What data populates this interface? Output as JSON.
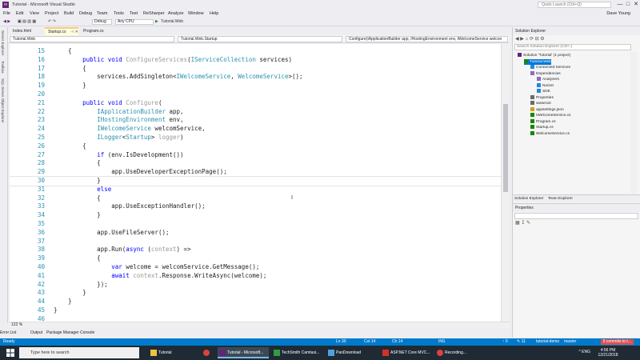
{
  "window": {
    "title": "Tutorial - Microsoft Visual Studio",
    "quick_launch_placeholder": "Quick Launch (Ctrl+Q)",
    "min": "—",
    "max": "□",
    "close": "✕",
    "watermark": "solenovex"
  },
  "menu": {
    "items": [
      "File",
      "Edit",
      "View",
      "Project",
      "Build",
      "Debug",
      "Team",
      "Tools",
      "Test",
      "ReSharper",
      "Analyze",
      "Window",
      "Help"
    ],
    "user": "Dave Young"
  },
  "toolbar": {
    "config": "Debug",
    "platform": "Any CPU",
    "run_target": "Tutorial.Web"
  },
  "left_panels": [
    "Server Explorer",
    "Toolbox",
    "SQL Server Object Explorer"
  ],
  "tabs": [
    {
      "label": "Index.html"
    },
    {
      "label": "Startup.cs"
    },
    {
      "label": "Program.cs"
    }
  ],
  "navbar": {
    "project": "Tutorial.Web",
    "class": "Tutorial.Web.Startup",
    "member": "Configure(IApplicationBuilder app, IHostingEnvironment env, IWelcomeService welcon"
  },
  "editor": {
    "lines": [
      {
        "n": "15",
        "code": "    {"
      },
      {
        "n": "16",
        "code": "        public void ConfigureServices(IServiceCollection services)"
      },
      {
        "n": "17",
        "code": "        {"
      },
      {
        "n": "18",
        "code": "            services.AddSingleton<IWelcomeService, WelcomeService>();"
      },
      {
        "n": "19",
        "code": "        }"
      },
      {
        "n": "20",
        "code": ""
      },
      {
        "n": "21",
        "code": "        public void Configure("
      },
      {
        "n": "22",
        "code": "            IApplicationBuilder app,"
      },
      {
        "n": "23",
        "code": "            IHostingEnvironment env,"
      },
      {
        "n": "24",
        "code": "            IWelcomeService welcomService,"
      },
      {
        "n": "25",
        "code": "            ILogger<Startup> logger)"
      },
      {
        "n": "26",
        "code": "        {"
      },
      {
        "n": "27",
        "code": "            if (env.IsDevelopment())"
      },
      {
        "n": "28",
        "code": "            {"
      },
      {
        "n": "29",
        "code": "                app.UseDeveloperExceptionPage();"
      },
      {
        "n": "30",
        "code": "            }"
      },
      {
        "n": "31",
        "code": "            else"
      },
      {
        "n": "32",
        "code": "            {"
      },
      {
        "n": "33",
        "code": "                app.UseExceptionHandler();"
      },
      {
        "n": "34",
        "code": "            }"
      },
      {
        "n": "35",
        "code": ""
      },
      {
        "n": "36",
        "code": "            app.UseFileServer();"
      },
      {
        "n": "37",
        "code": ""
      },
      {
        "n": "38",
        "code": "            app.Run(async (context) =>"
      },
      {
        "n": "39",
        "code": "            {"
      },
      {
        "n": "40",
        "code": "                var welcome = welcomService.GetMessage();"
      },
      {
        "n": "41",
        "code": "                await context.Response.WriteAsync(welcome);"
      },
      {
        "n": "42",
        "code": "            });"
      },
      {
        "n": "43",
        "code": "        }"
      },
      {
        "n": "44",
        "code": "    }"
      },
      {
        "n": "45",
        "code": "}"
      },
      {
        "n": "46",
        "code": ""
      }
    ],
    "current_line": "30",
    "zoom": "122 %"
  },
  "bottom_tabs": [
    "Error List",
    "Output",
    "Package Manager Console"
  ],
  "solution_explorer": {
    "title": "Solution Explorer",
    "search_placeholder": "Search Solution Explorer (Ctrl+;)",
    "items": [
      {
        "label": "Solution 'Tutorial' (1 project)",
        "indent": 0
      },
      {
        "label": "Tutorial.Web",
        "indent": 1
      },
      {
        "label": "Connected Services",
        "indent": 2
      },
      {
        "label": "Dependencies",
        "indent": 2
      },
      {
        "label": "Analyzers",
        "indent": 3
      },
      {
        "label": "NuGet",
        "indent": 3
      },
      {
        "label": "SDK",
        "indent": 3
      },
      {
        "label": "Properties",
        "indent": 2
      },
      {
        "label": "wwwroot",
        "indent": 2
      },
      {
        "label": "appsettings.json",
        "indent": 2
      },
      {
        "label": "IWelcomeService.cs",
        "indent": 2
      },
      {
        "label": "Program.cs",
        "indent": 2
      },
      {
        "label": "Startup.cs",
        "indent": 2
      },
      {
        "label": "WelcomeService.cs",
        "indent": 2
      }
    ],
    "bottom_tabs": [
      "Solution Explorer",
      "Team Explorer"
    ]
  },
  "properties": {
    "title": "Properties"
  },
  "status": {
    "ready": "Ready",
    "ln": "Ln 30",
    "col": "Col 14",
    "ch": "Ch 14",
    "ins": "INS",
    "up": "↑ 0",
    "edits": "✎ 11",
    "repo": "tutorial-demo",
    "branch": "master",
    "pub": "5 commits to t..."
  },
  "taskbar": {
    "search": "Type here to search",
    "tasks": [
      "Tutorial",
      "Tutorial - Microsoft...",
      "TechSmith Camtasi...",
      "PanDownload",
      "ASP.NET Core MVC...",
      "Recording..."
    ],
    "time": "4:56 PM",
    "date": "12/21/2018",
    "tray": "^  ENG"
  },
  "colors": {
    "keyword": "#0000ff",
    "type": "#2b91af",
    "status": "#007acc",
    "selection": "#0078d7"
  }
}
